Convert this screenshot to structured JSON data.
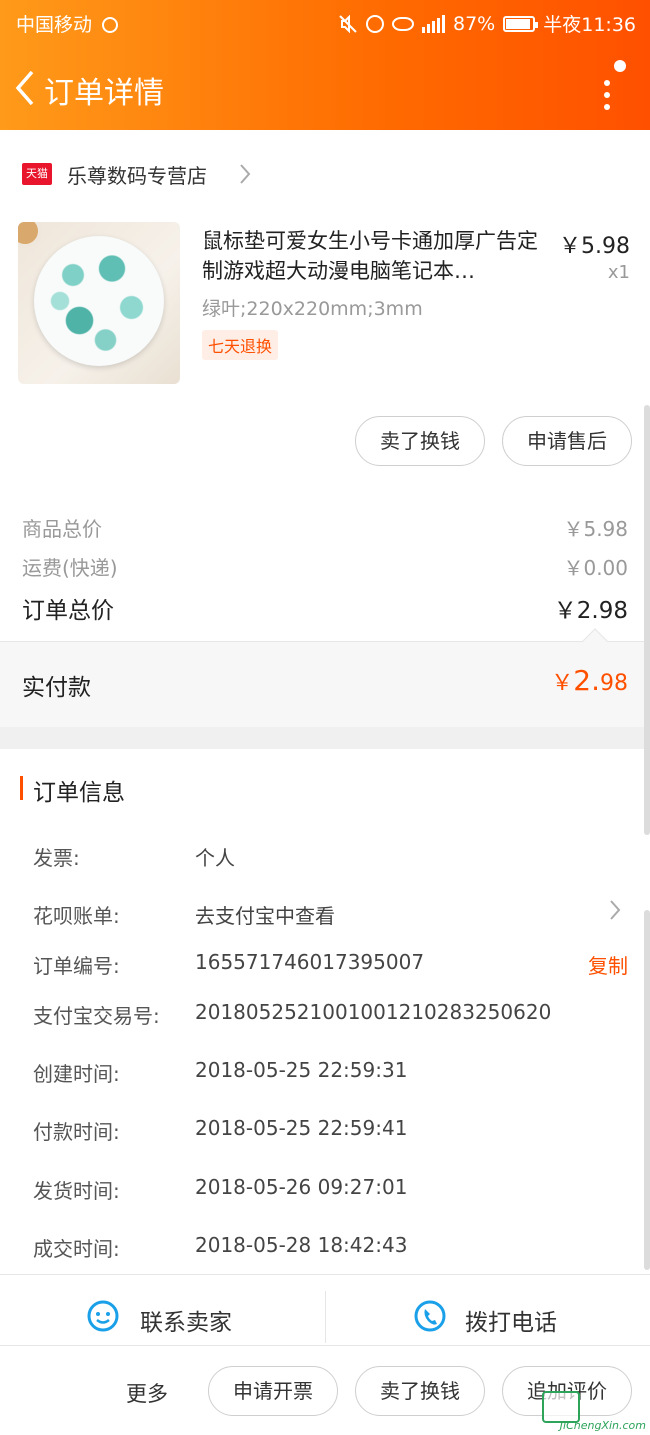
{
  "status": {
    "carrier": "中国移动",
    "battery": "87%",
    "time": "半夜11:36",
    "network": "4G"
  },
  "nav": {
    "title": "订单详情"
  },
  "store": {
    "badge": "天猫",
    "name": "乐尊数码专营店"
  },
  "product": {
    "title": "鼠标垫可爱女生小号卡通加厚广告定制游戏超大动漫电脑笔记本…",
    "price": "￥5.98",
    "qty": "x1",
    "spec": "绿叶;220x220mm;3mm",
    "tag": "七天退换"
  },
  "actions": {
    "sell": "卖了换钱",
    "aftersale": "申请售后"
  },
  "summary": {
    "goods_label": "商品总价",
    "goods_value": "￥5.98",
    "shipping_label": "运费(快递)",
    "shipping_value": "￥0.00",
    "total_label": "订单总价",
    "total_value": "￥2.98",
    "paid_label": "实付款",
    "paid_symbol": "￥",
    "paid_int": "2.",
    "paid_dec": "98"
  },
  "order_info": {
    "title": "订单信息",
    "rows": [
      {
        "label": "发票:",
        "value": "个人"
      },
      {
        "label": "花呗账单:",
        "value": "去支付宝中查看"
      },
      {
        "label": "订单编号:",
        "value": "165571746017395007"
      },
      {
        "label": "支付宝交易号:",
        "value": "2018052521001001210283250620"
      },
      {
        "label": "创建时间:",
        "value": "2018-05-25 22:59:31"
      },
      {
        "label": "付款时间:",
        "value": "2018-05-25 22:59:41"
      },
      {
        "label": "发货时间:",
        "value": "2018-05-26 09:27:01"
      },
      {
        "label": "成交时间:",
        "value": "2018-05-28 18:42:43"
      }
    ],
    "copy_label": "复制"
  },
  "contact": {
    "seller": "联系卖家",
    "phone": "拨打电话"
  },
  "bottom": {
    "more": "更多",
    "invoice": "申请开票",
    "sell": "卖了换钱",
    "review": "追加评价"
  },
  "watermark": {
    "text": "JiChengXin.com"
  },
  "colors": {
    "accent": "#ff5000",
    "header_start": "#ff9a1a",
    "header_end": "#ff5000",
    "tmall_red": "#e8152d",
    "contact_icon": "#1aa0e8"
  }
}
